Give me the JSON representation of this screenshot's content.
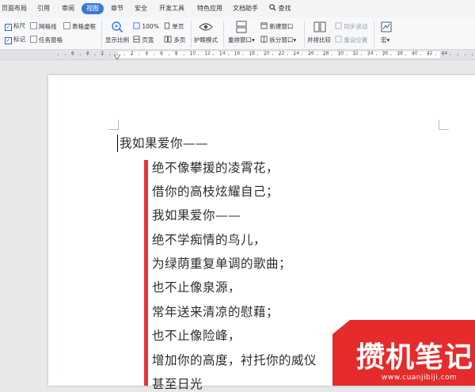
{
  "menubar": {
    "items": [
      "页面布局",
      "引用",
      "审阅",
      "视图",
      "章节",
      "安全",
      "开发工具",
      "特色应用",
      "文档助手"
    ],
    "active": "视图",
    "search_label": "查找"
  },
  "toolbar": {
    "checkboxes": [
      {
        "label": "标尺",
        "checked": true
      },
      {
        "label": "网格线",
        "checked": false
      },
      {
        "label": "表格虚框",
        "checked": false
      },
      {
        "label": "标记",
        "checked": true
      },
      {
        "label": "任务窗格",
        "checked": false
      }
    ],
    "show_ratio": "显示比例",
    "zoom": "100%",
    "page_width": "页宽",
    "single_page": "单页",
    "multi_page": "多页",
    "eye_mode": "护眼模式",
    "arrange_window": "重排窗口",
    "new_window": "新建窗口",
    "split_window": "拆分窗口",
    "side_by_side": "并排比较",
    "sync_scroll": "同步滚动",
    "reset_position": "重设位置",
    "macro": "宏"
  },
  "ruler": {
    "numbers": [
      "6",
      "4",
      "2",
      "2",
      "4",
      "6",
      "8",
      "10",
      "12",
      "14",
      "16",
      "18",
      "20",
      "22",
      "24",
      "26",
      "28",
      "30",
      "32",
      "34",
      "36",
      "38",
      "40",
      "42",
      "44"
    ]
  },
  "document": {
    "first_line": "我如果爱你——",
    "lines": [
      "绝不像攀援的凌霄花，",
      "借你的高枝炫耀自己；",
      "我如果爱你——",
      "绝不学痴情的鸟儿，",
      "为绿荫重复单调的歌曲；",
      "也不止像泉源，",
      "常年送来清凉的慰藉；",
      "也不止像险峰，",
      "增加你的高度，衬托你的威仪",
      "甚至日光"
    ]
  },
  "watermark": {
    "title": "攒机笔记",
    "url": "www.cuanjibiji.com",
    "color": "#e52b2b"
  }
}
